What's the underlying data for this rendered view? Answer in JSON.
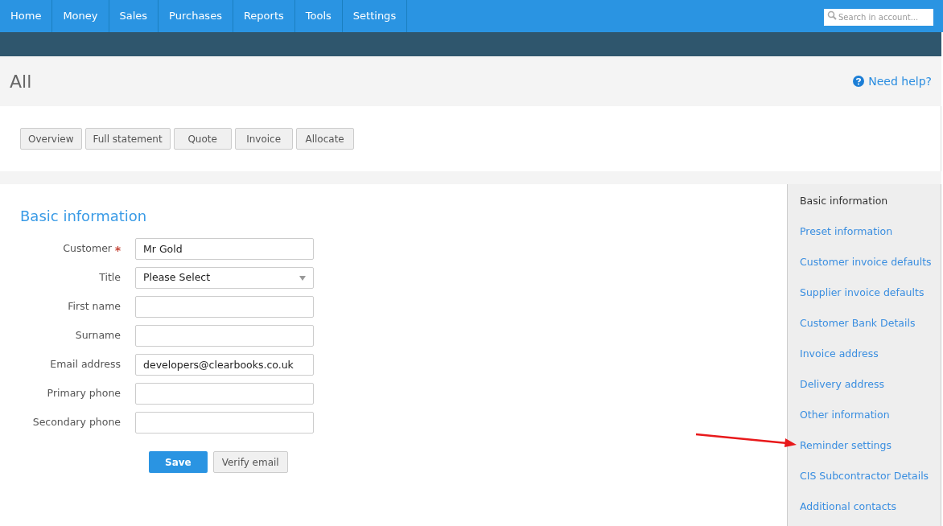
{
  "nav": {
    "items": [
      "Home",
      "Money",
      "Sales",
      "Purchases",
      "Reports",
      "Tools",
      "Settings"
    ],
    "search": {
      "placeholder": "Search in account..."
    }
  },
  "header": {
    "title": "All",
    "help": "Need help?"
  },
  "actions": [
    "Overview",
    "Full statement",
    "Quote",
    "Invoice",
    "Allocate"
  ],
  "form": {
    "title": "Basic information",
    "fields": [
      {
        "label": "Customer",
        "required": true,
        "kind": "text",
        "value": "Mr Gold"
      },
      {
        "label": "Title",
        "required": false,
        "kind": "select",
        "value": "Please Select"
      },
      {
        "label": "First name",
        "required": false,
        "kind": "text"
      },
      {
        "label": "Surname",
        "required": false,
        "kind": "text"
      },
      {
        "label": "Email address",
        "required": false,
        "kind": "text",
        "value": "developers@clearbooks.co.uk"
      },
      {
        "label": "Primary phone",
        "required": false,
        "kind": "text"
      },
      {
        "label": "Secondary phone",
        "required": false,
        "kind": "text"
      }
    ],
    "buttons": [
      {
        "label": "Save",
        "kind": "primary"
      },
      {
        "label": "Verify email",
        "kind": "secondary"
      }
    ]
  },
  "sidebar": {
    "items": [
      {
        "label": "Basic information",
        "selected": true
      },
      {
        "label": "Preset information",
        "selected": false
      },
      {
        "label": "Customer invoice defaults",
        "selected": false
      },
      {
        "label": "Supplier invoice defaults",
        "selected": false
      },
      {
        "label": "Customer Bank Details",
        "selected": false
      },
      {
        "label": "Invoice address",
        "selected": false
      },
      {
        "label": "Delivery address",
        "selected": false
      },
      {
        "label": "Other information",
        "selected": false
      },
      {
        "label": "Reminder settings",
        "selected": false
      },
      {
        "label": "CIS Subcontractor Details",
        "selected": false
      },
      {
        "label": "Additional contacts",
        "selected": false
      }
    ]
  }
}
